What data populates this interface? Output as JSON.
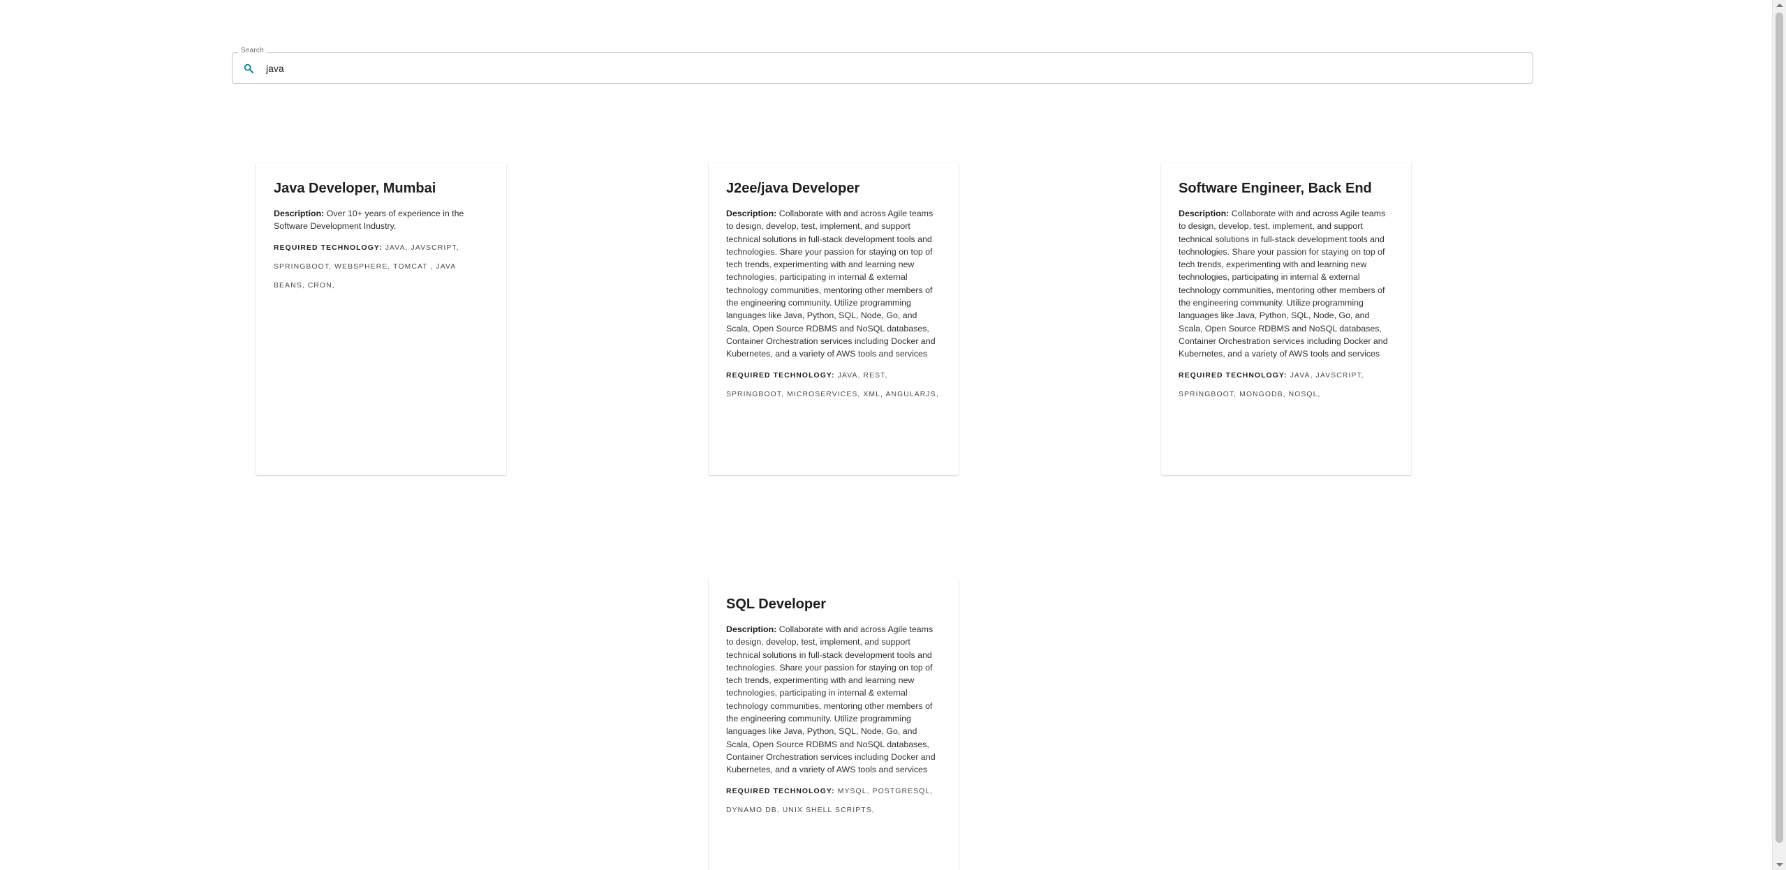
{
  "search": {
    "legend": "Search",
    "value": "java",
    "icon": "search-icon",
    "icon_color": "#007f8c"
  },
  "jobs": [
    {
      "title": "Java Developer, Mumbai",
      "description_label": "Description:",
      "description": "Over 10+ years of experience in the Software Development Industry.",
      "tech_label": "Required Technology:",
      "tech": "JAVA, JAVSCRIPT, SPRINGBOOT, WEBSPHERE, TOMCAT , JAVA BEANS, CRON,"
    },
    {
      "title": "J2ee/java Developer",
      "description_label": "Description:",
      "description": "Collaborate with and across Agile teams to design, develop, test, implement, and support technical solutions in full-stack development tools and technologies. Share your passion for staying on top of tech trends, experimenting with and learning new technologies, participating in internal & external technology communities, mentoring other members of the engineering community. Utilize programming languages like Java, Python, SQL, Node, Go, and Scala, Open Source RDBMS and NoSQL databases, Container Orchestration services including Docker and Kubernetes, and a variety of AWS tools and services",
      "tech_label": "Required Technology:",
      "tech": "JAVA, REST, SPRINGBOOT, MICROSERVICES, XML, ANGULARJS,"
    },
    {
      "title": "Software Engineer, Back End",
      "description_label": "Description:",
      "description": "Collaborate with and across Agile teams to design, develop, test, implement, and support technical solutions in full-stack development tools and technologies. Share your passion for staying on top of tech trends, experimenting with and learning new technologies, participating in internal & external technology communities, mentoring other members of the engineering community. Utilize programming languages like Java, Python, SQL, Node, Go, and Scala, Open Source RDBMS and NoSQL databases, Container Orchestration services including Docker and Kubernetes, and a variety of AWS tools and services",
      "tech_label": "Required Technology:",
      "tech": "JAVA, JAVSCRIPT, SPRINGBOOT, MONGODB, NOSQL,"
    },
    {
      "title": "SQL Developer",
      "description_label": "Description:",
      "description": "Collaborate with and across Agile teams to design, develop, test, implement, and support technical solutions in full-stack development tools and technologies. Share your passion for staying on top of tech trends, experimenting with and learning new technologies, participating in internal & external technology communities, mentoring other members of the engineering community. Utilize programming languages like Java, Python, SQL, Node, Go, and Scala, Open Source RDBMS and NoSQL databases, Container Orchestration services including Docker and Kubernetes, and a variety of AWS tools and services",
      "tech_label": "Required Technology:",
      "tech": "MYSQL, POSTGRESQL, DYNAMO DB, UNIX SHELL SCRIPTS,"
    }
  ]
}
